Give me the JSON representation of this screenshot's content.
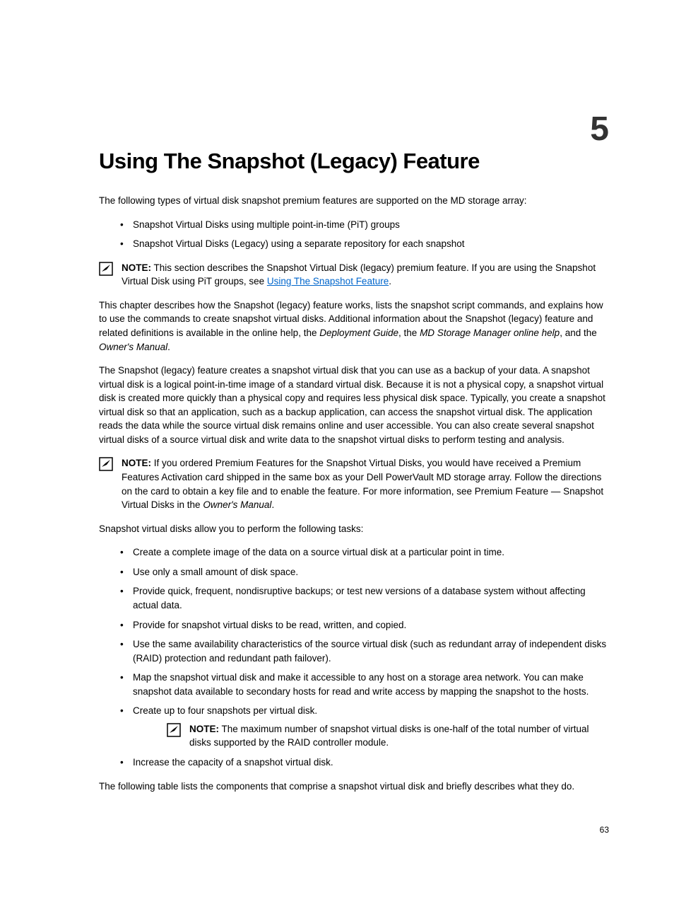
{
  "chapter": {
    "number": "5",
    "title": "Using The Snapshot (Legacy) Feature"
  },
  "intro": "The following types of virtual disk snapshot premium features are supported on the MD storage array:",
  "list1": [
    "Snapshot Virtual Disks using multiple point-in-time (PiT) groups",
    "Snapshot Virtual Disks (Legacy) using a separate repository for each snapshot"
  ],
  "note1": {
    "label": "NOTE:",
    "text_before_link": " This section describes the Snapshot Virtual Disk (legacy) premium feature. If you are using the Snapshot Virtual Disk using PiT groups, see ",
    "link_text": "Using The Snapshot Feature",
    "text_after_link": "."
  },
  "para2_before_italic1": "This chapter describes how the Snapshot (legacy) feature works, lists the snapshot script commands, and explains how to use the commands to create snapshot virtual disks. Additional information about the Snapshot (legacy) feature and related definitions is available in the online help, the ",
  "para2_italic1": "Deployment Guide",
  "para2_mid1": ", the ",
  "para2_italic2": "MD Storage Manager online help",
  "para2_mid2": ", and the ",
  "para2_italic3": "Owner's Manual",
  "para2_end": ".",
  "para3": "The Snapshot (legacy) feature creates a snapshot virtual disk that you can use as a backup of your data. A snapshot virtual disk is a logical point-in-time image of a standard virtual disk. Because it is not a physical copy, a snapshot virtual disk is created more quickly than a physical copy and requires less physical disk space. Typically, you create a snapshot virtual disk so that an application, such as a backup application, can access the snapshot virtual disk. The application reads the data while the source virtual disk remains online and user accessible. You can also create several snapshot virtual disks of a source virtual disk and write data to the snapshot virtual disks to perform testing and analysis.",
  "note2": {
    "label": "NOTE:",
    "text_before_italic": " If you ordered Premium Features for the Snapshot Virtual Disks, you would have received a Premium Features Activation card shipped in the same box as your Dell PowerVault MD storage array. Follow the directions on the card to obtain a key file and to enable the feature. For more information, see Premium Feature — Snapshot Virtual Disks in the ",
    "italic": "Owner's Manual",
    "text_after_italic": "."
  },
  "para4": "Snapshot virtual disks allow you to perform the following tasks:",
  "list2": [
    "Create a complete image of the data on a source virtual disk at a particular point in time.",
    "Use only a small amount of disk space.",
    "Provide quick, frequent, nondisruptive backups; or test new versions of a database system without affecting actual data.",
    "Provide for snapshot virtual disks to be read, written, and copied.",
    "Use the same availability characteristics of the source virtual disk (such as redundant array of independent disks (RAID) protection and redundant path failover).",
    "Map the snapshot virtual disk and make it accessible to any host on a storage area network. You can make snapshot data available to secondary hosts for read and write access by mapping the snapshot to the hosts.",
    "Create up to four snapshots per virtual disk.",
    "Increase the capacity of a snapshot virtual disk."
  ],
  "note3": {
    "label": "NOTE:",
    "text": " The maximum number of snapshot virtual disks is one-half of the total number of virtual disks supported by the RAID controller module."
  },
  "para5": "The following table lists the components that comprise a snapshot virtual disk and briefly describes what they do.",
  "page_number": "63"
}
